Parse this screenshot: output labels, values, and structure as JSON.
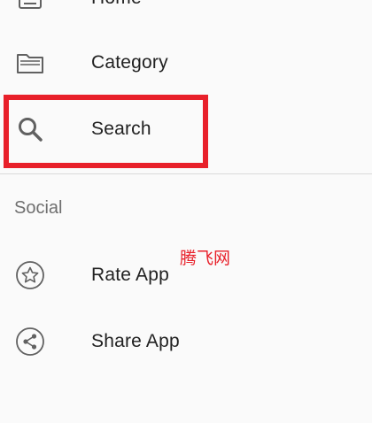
{
  "drawer": {
    "items": [
      {
        "id": "home",
        "label": "Home",
        "icon": "home-list-icon"
      },
      {
        "id": "category",
        "label": "Category",
        "icon": "folder-icon"
      },
      {
        "id": "search",
        "label": "Search",
        "icon": "search-icon"
      }
    ],
    "social_header": "Social",
    "social_items": [
      {
        "id": "rate",
        "label": "Rate App",
        "icon": "star-icon"
      },
      {
        "id": "share",
        "label": "Share App",
        "icon": "share-icon"
      }
    ]
  },
  "watermark": "腾飞网",
  "colors": {
    "highlight": "#e8202a",
    "icon": "#616161",
    "text": "#212121",
    "section_header": "#6f6f6f",
    "background": "#fafafa"
  }
}
